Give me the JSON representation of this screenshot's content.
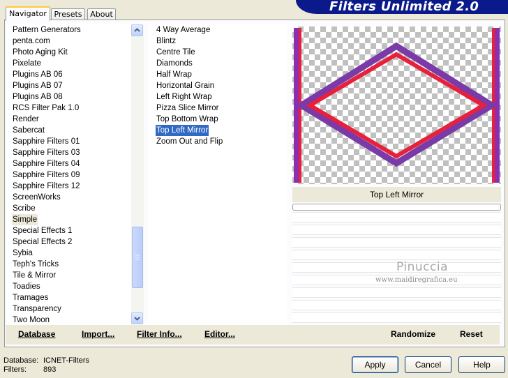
{
  "banner_title": "Filters Unlimited 2.0",
  "tabs": [
    {
      "label": "Navigator",
      "active": true
    },
    {
      "label": "Presets",
      "active": false
    },
    {
      "label": "About",
      "active": false
    }
  ],
  "categories": [
    "Pattern Generators",
    "penta.com",
    "Photo Aging Kit",
    "Pixelate",
    "Plugins AB 06",
    "Plugins AB 07",
    "Plugins AB 08",
    "RCS Filter Pak 1.0",
    "Render",
    "Sabercat",
    "Sapphire Filters 01",
    "Sapphire Filters 03",
    "Sapphire Filters 04",
    "Sapphire Filters 09",
    "Sapphire Filters 12",
    "ScreenWorks",
    "Scribe",
    "Simple",
    "Special Effects 1",
    "Special Effects 2",
    "Sybia",
    "Teph's Tricks",
    "Tile & Mirror",
    "Toadies",
    "Tramages",
    "Transparency",
    "Two Moon"
  ],
  "selected_category": "Simple",
  "filters": [
    "4 Way Average",
    "Blintz",
    "Centre Tile",
    "Diamonds",
    "Half Wrap",
    "Horizontal Grain",
    "Left Right Wrap",
    "Pizza Slice Mirror",
    "Top Bottom Wrap",
    "Top Left Mirror",
    "Zoom Out and Flip"
  ],
  "selected_filter": "Top Left Mirror",
  "preview": {
    "label": "Top Left Mirror",
    "watermark_name": "Pinuccia",
    "watermark_url": "www.maidiregrafica.eu"
  },
  "bottom_buttons": {
    "database": "Database",
    "import": "Import...",
    "filter_info": "Filter Info...",
    "editor": "Editor...",
    "randomize": "Randomize",
    "reset": "Reset"
  },
  "footer": {
    "database_label": "Database:",
    "database_value": "ICNET-Filters",
    "filters_label": "Filters:",
    "filters_value": "893",
    "apply": "Apply",
    "cancel": "Cancel",
    "help": "Help"
  },
  "colors": {
    "banner": "#0a1a8a",
    "selection": "#316ac5",
    "frame_red": "#e8203c",
    "frame_purple": "#7a3aa8"
  }
}
